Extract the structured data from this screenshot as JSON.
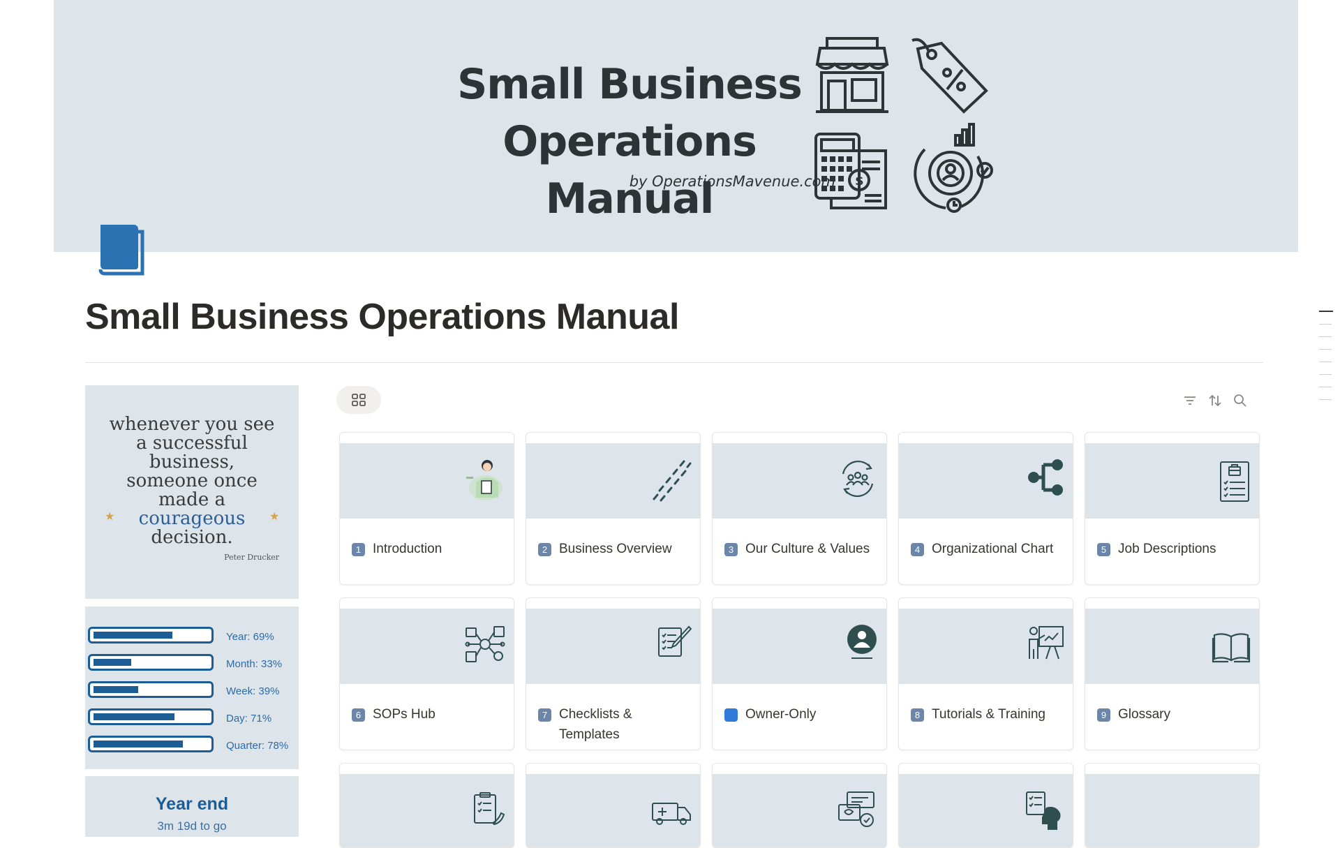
{
  "cover": {
    "title_line1": "Small Business",
    "title_line2": "Operations Manual",
    "byline": "by OperationsMavenue.com"
  },
  "page": {
    "title": "Small Business Operations Manual"
  },
  "quote": {
    "text_start": "whenever you see a successful business, someone once made a",
    "accent": "courageous",
    "text_end": "decision.",
    "author": "Peter Drucker"
  },
  "progress": [
    {
      "label": "Year: 69%",
      "value": 0.69
    },
    {
      "label": "Month: 33%",
      "value": 0.33
    },
    {
      "label": "Week: 39%",
      "value": 0.39
    },
    {
      "label": "Day: 71%",
      "value": 0.71
    },
    {
      "label": "Quarter: 78%",
      "value": 0.78
    }
  ],
  "year_end": {
    "title": "Year end",
    "subtitle": "3m 19d to go"
  },
  "cards": [
    {
      "badge": "1",
      "title": "Introduction",
      "icon": "person-clipboard-icon"
    },
    {
      "badge": "2",
      "title": "Business Overview",
      "icon": "footsteps-icon"
    },
    {
      "badge": "3",
      "title": "Our Culture & Values",
      "icon": "team-cycle-icon"
    },
    {
      "badge": "4",
      "title": "Organizational Chart",
      "icon": "org-chart-icon"
    },
    {
      "badge": "5",
      "title": "Job Descriptions",
      "icon": "job-document-icon"
    },
    {
      "badge": "6",
      "title": "SOPs Hub",
      "icon": "process-network-icon"
    },
    {
      "badge": "7",
      "title": "Checklists & Templates",
      "icon": "checklist-pen-icon"
    },
    {
      "badge": "",
      "title": "Owner-Only",
      "icon": "owner-only-icon"
    },
    {
      "badge": "8",
      "title": "Tutorials & Training",
      "icon": "presentation-icon"
    },
    {
      "badge": "9",
      "title": "Glossary",
      "icon": "open-book-icon"
    }
  ],
  "colors": {
    "cover_bg": "#dde5ea",
    "accent_blue": "#1d5d96",
    "icon_dark": "#2f4f4f"
  }
}
